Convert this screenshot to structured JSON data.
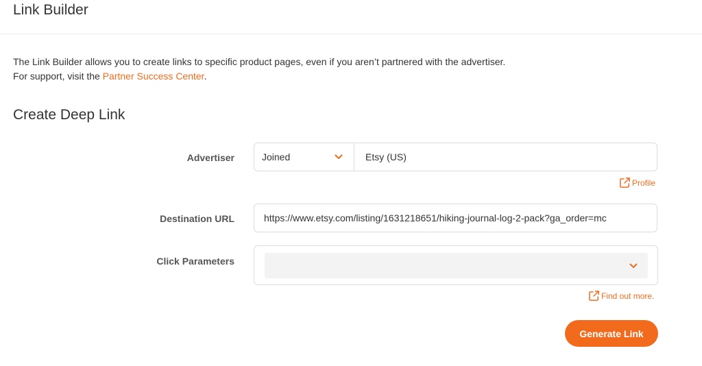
{
  "header": {
    "title": "Link Builder"
  },
  "intro": {
    "line1": "The Link Builder allows you to create links to specific product pages, even if you aren’t partnered with the advertiser.",
    "line2_prefix": "For support, visit the ",
    "support_link": "Partner Success Center",
    "line2_suffix": "."
  },
  "form": {
    "title": "Create Deep Link",
    "advertiser": {
      "label": "Advertiser",
      "filter_value": "Joined",
      "selected": "Etsy (US)",
      "profile_link": "Profile"
    },
    "destination": {
      "label": "Destination URL",
      "value": "https://www.etsy.com/listing/1631218651/hiking-journal-log-2-pack?ga_order=mc"
    },
    "click_parameters": {
      "label": "Click Parameters",
      "value": "",
      "help_link": "Find out more."
    },
    "generate_label": "Generate Link"
  },
  "colors": {
    "accent": "#f26b1d",
    "border": "#dcdcdc",
    "field_bg": "#f3f3f3"
  },
  "icons": {
    "chevron": "chevron-down-icon",
    "external": "external-link-icon"
  }
}
